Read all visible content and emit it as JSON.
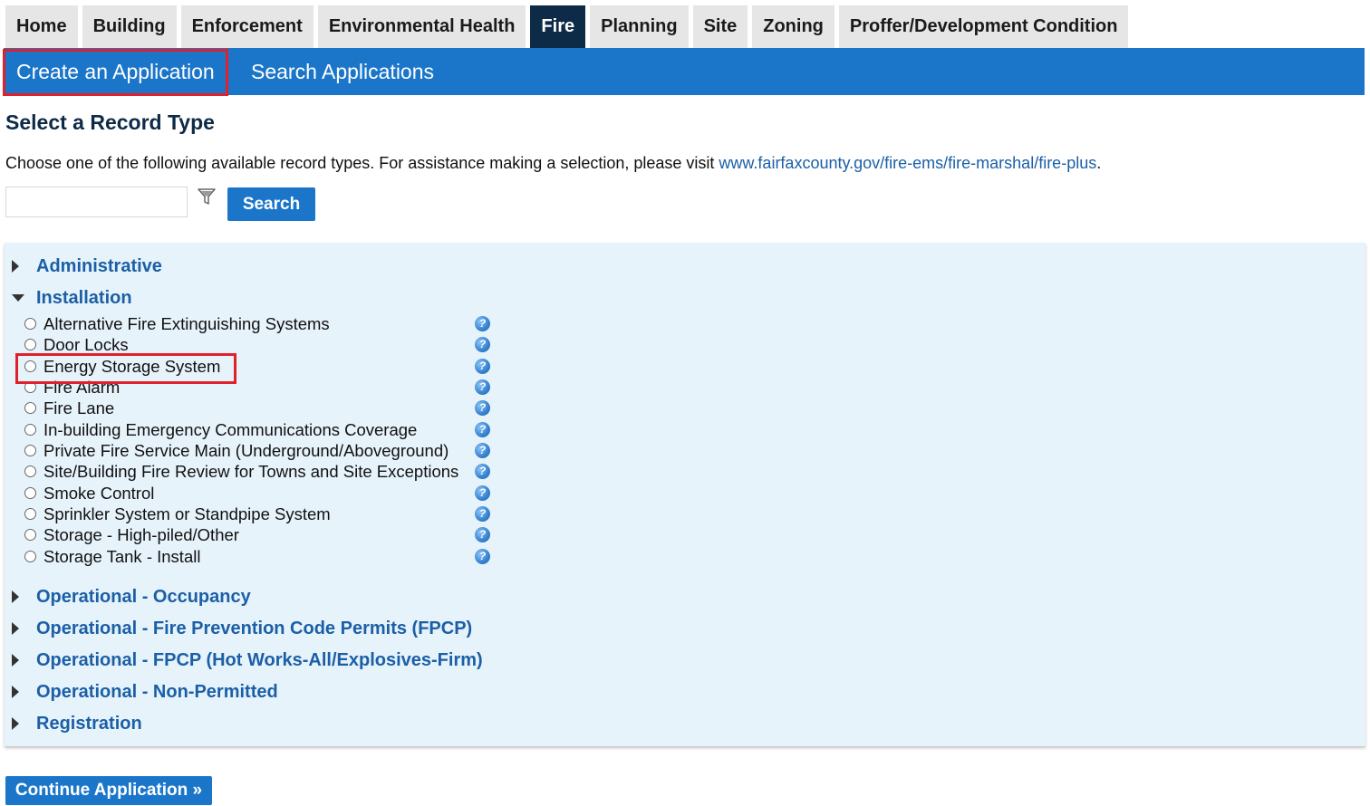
{
  "tabs": [
    {
      "label": "Home"
    },
    {
      "label": "Building"
    },
    {
      "label": "Enforcement"
    },
    {
      "label": "Environmental Health"
    },
    {
      "label": "Fire"
    },
    {
      "label": "Planning"
    },
    {
      "label": "Site"
    },
    {
      "label": "Zoning"
    },
    {
      "label": "Proffer/Development Condition"
    }
  ],
  "active_tab": "Fire",
  "subnav": {
    "create": "Create an Application",
    "search": "Search Applications"
  },
  "page": {
    "title": "Select a Record Type",
    "intro_text": "Choose one of the following available record types.  For assistance making a selection, please visit ",
    "intro_link": "www.fairfaxcounty.gov/fire-ems/fire-marshal/fire-plus",
    "intro_end": "."
  },
  "search": {
    "value": "",
    "button": "Search",
    "filter_icon": "funnel-icon"
  },
  "categories": {
    "administrative": "Administrative",
    "installation": "Installation",
    "operational_occupancy": "Operational - Occupancy",
    "operational_fpcp": "Operational - Fire Prevention Code Permits (FPCP)",
    "operational_fpcp_hot": "Operational - FPCP (Hot Works-All/Explosives-Firm)",
    "operational_nonpermitted": "Operational - Non-Permitted",
    "registration": "Registration"
  },
  "installation_items": [
    "Alternative Fire Extinguishing Systems",
    "Door Locks",
    "Energy Storage System",
    "Fire Alarm",
    "Fire Lane",
    "In-building Emergency Communications Coverage",
    "Private Fire Service Main (Underground/Aboveground)",
    "Site/Building Fire Review for Towns and Site Exceptions",
    "Smoke Control",
    "Sprinkler System or Standpipe System",
    "Storage - High-piled/Other",
    "Storage Tank - Install"
  ],
  "help_glyph": "?",
  "continue_button": "Continue Application »",
  "colors": {
    "primary": "#1b76c9",
    "active_tab": "#0d2a47",
    "link": "#1b5fa6",
    "panel": "#e7f3fb",
    "highlight": "#e0202a"
  }
}
